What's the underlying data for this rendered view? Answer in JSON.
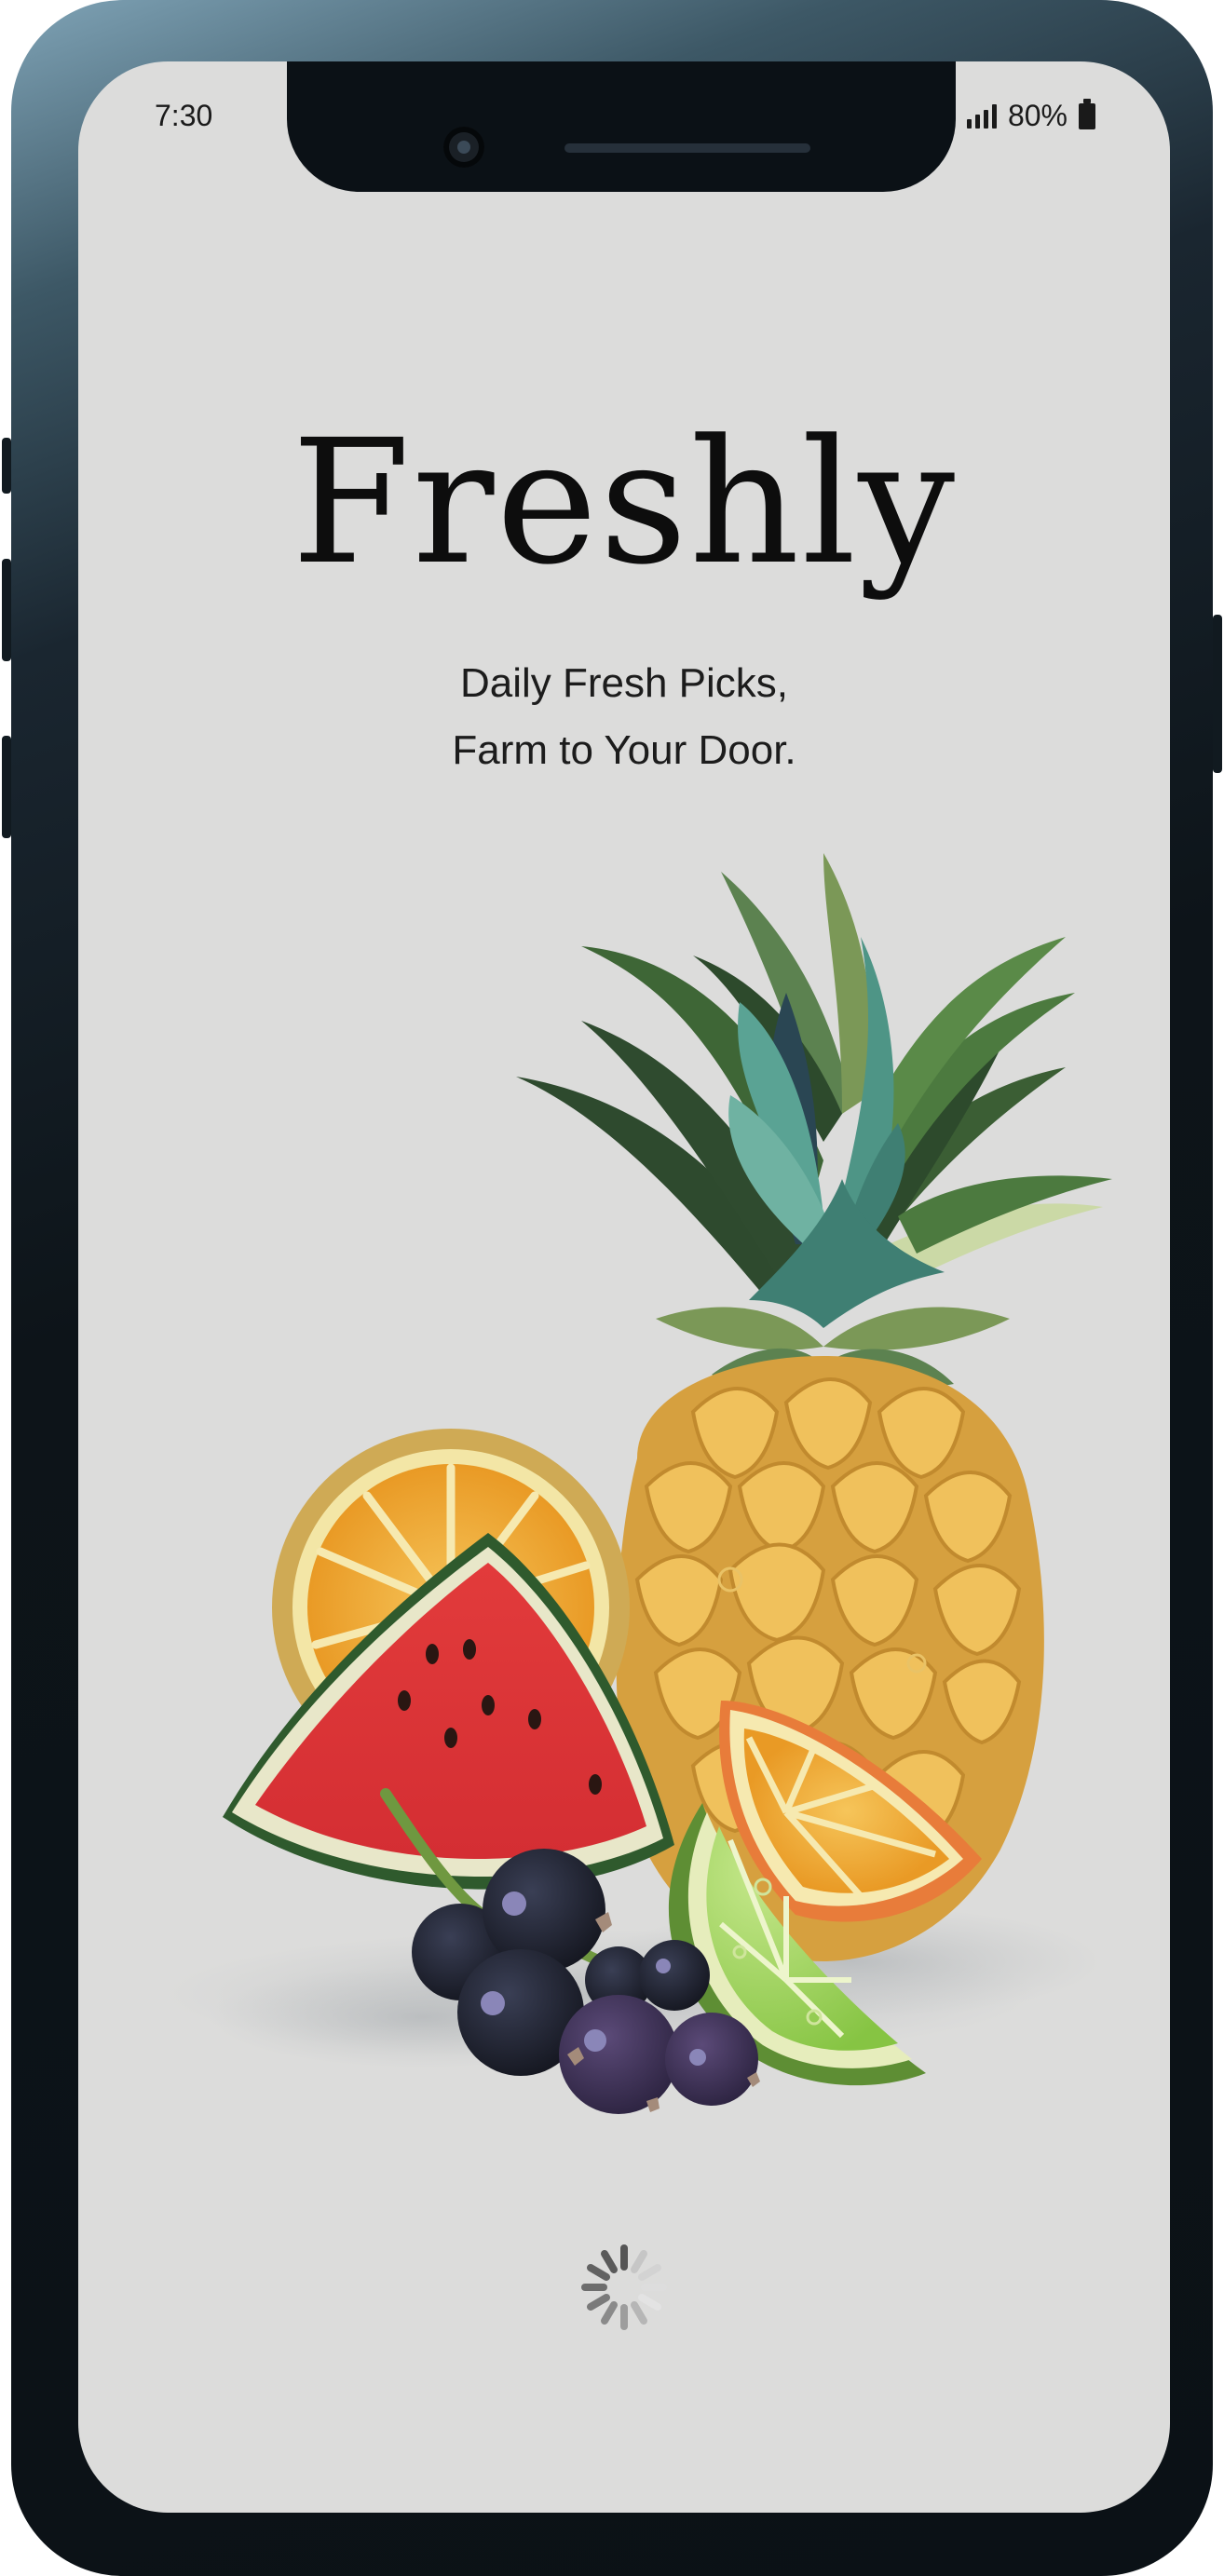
{
  "status_bar": {
    "time": "7:30",
    "battery_percent": "80%"
  },
  "splash": {
    "app_name": "Freshly",
    "tagline_line1": "Daily Fresh Picks,",
    "tagline_line2": "Farm to Your Door."
  },
  "illustration": {
    "items": [
      "pineapple",
      "orange-slice",
      "watermelon-slice",
      "blackcurrants",
      "lime-wedge",
      "orange-wedge"
    ]
  },
  "icons": {
    "loading": "loading-spinner-icon",
    "signal": "signal-icon",
    "battery": "battery-icon"
  },
  "colors": {
    "screen_background": "#dcdcdb",
    "title_text": "#0d0d0d",
    "device_frame": "#0b1116"
  }
}
